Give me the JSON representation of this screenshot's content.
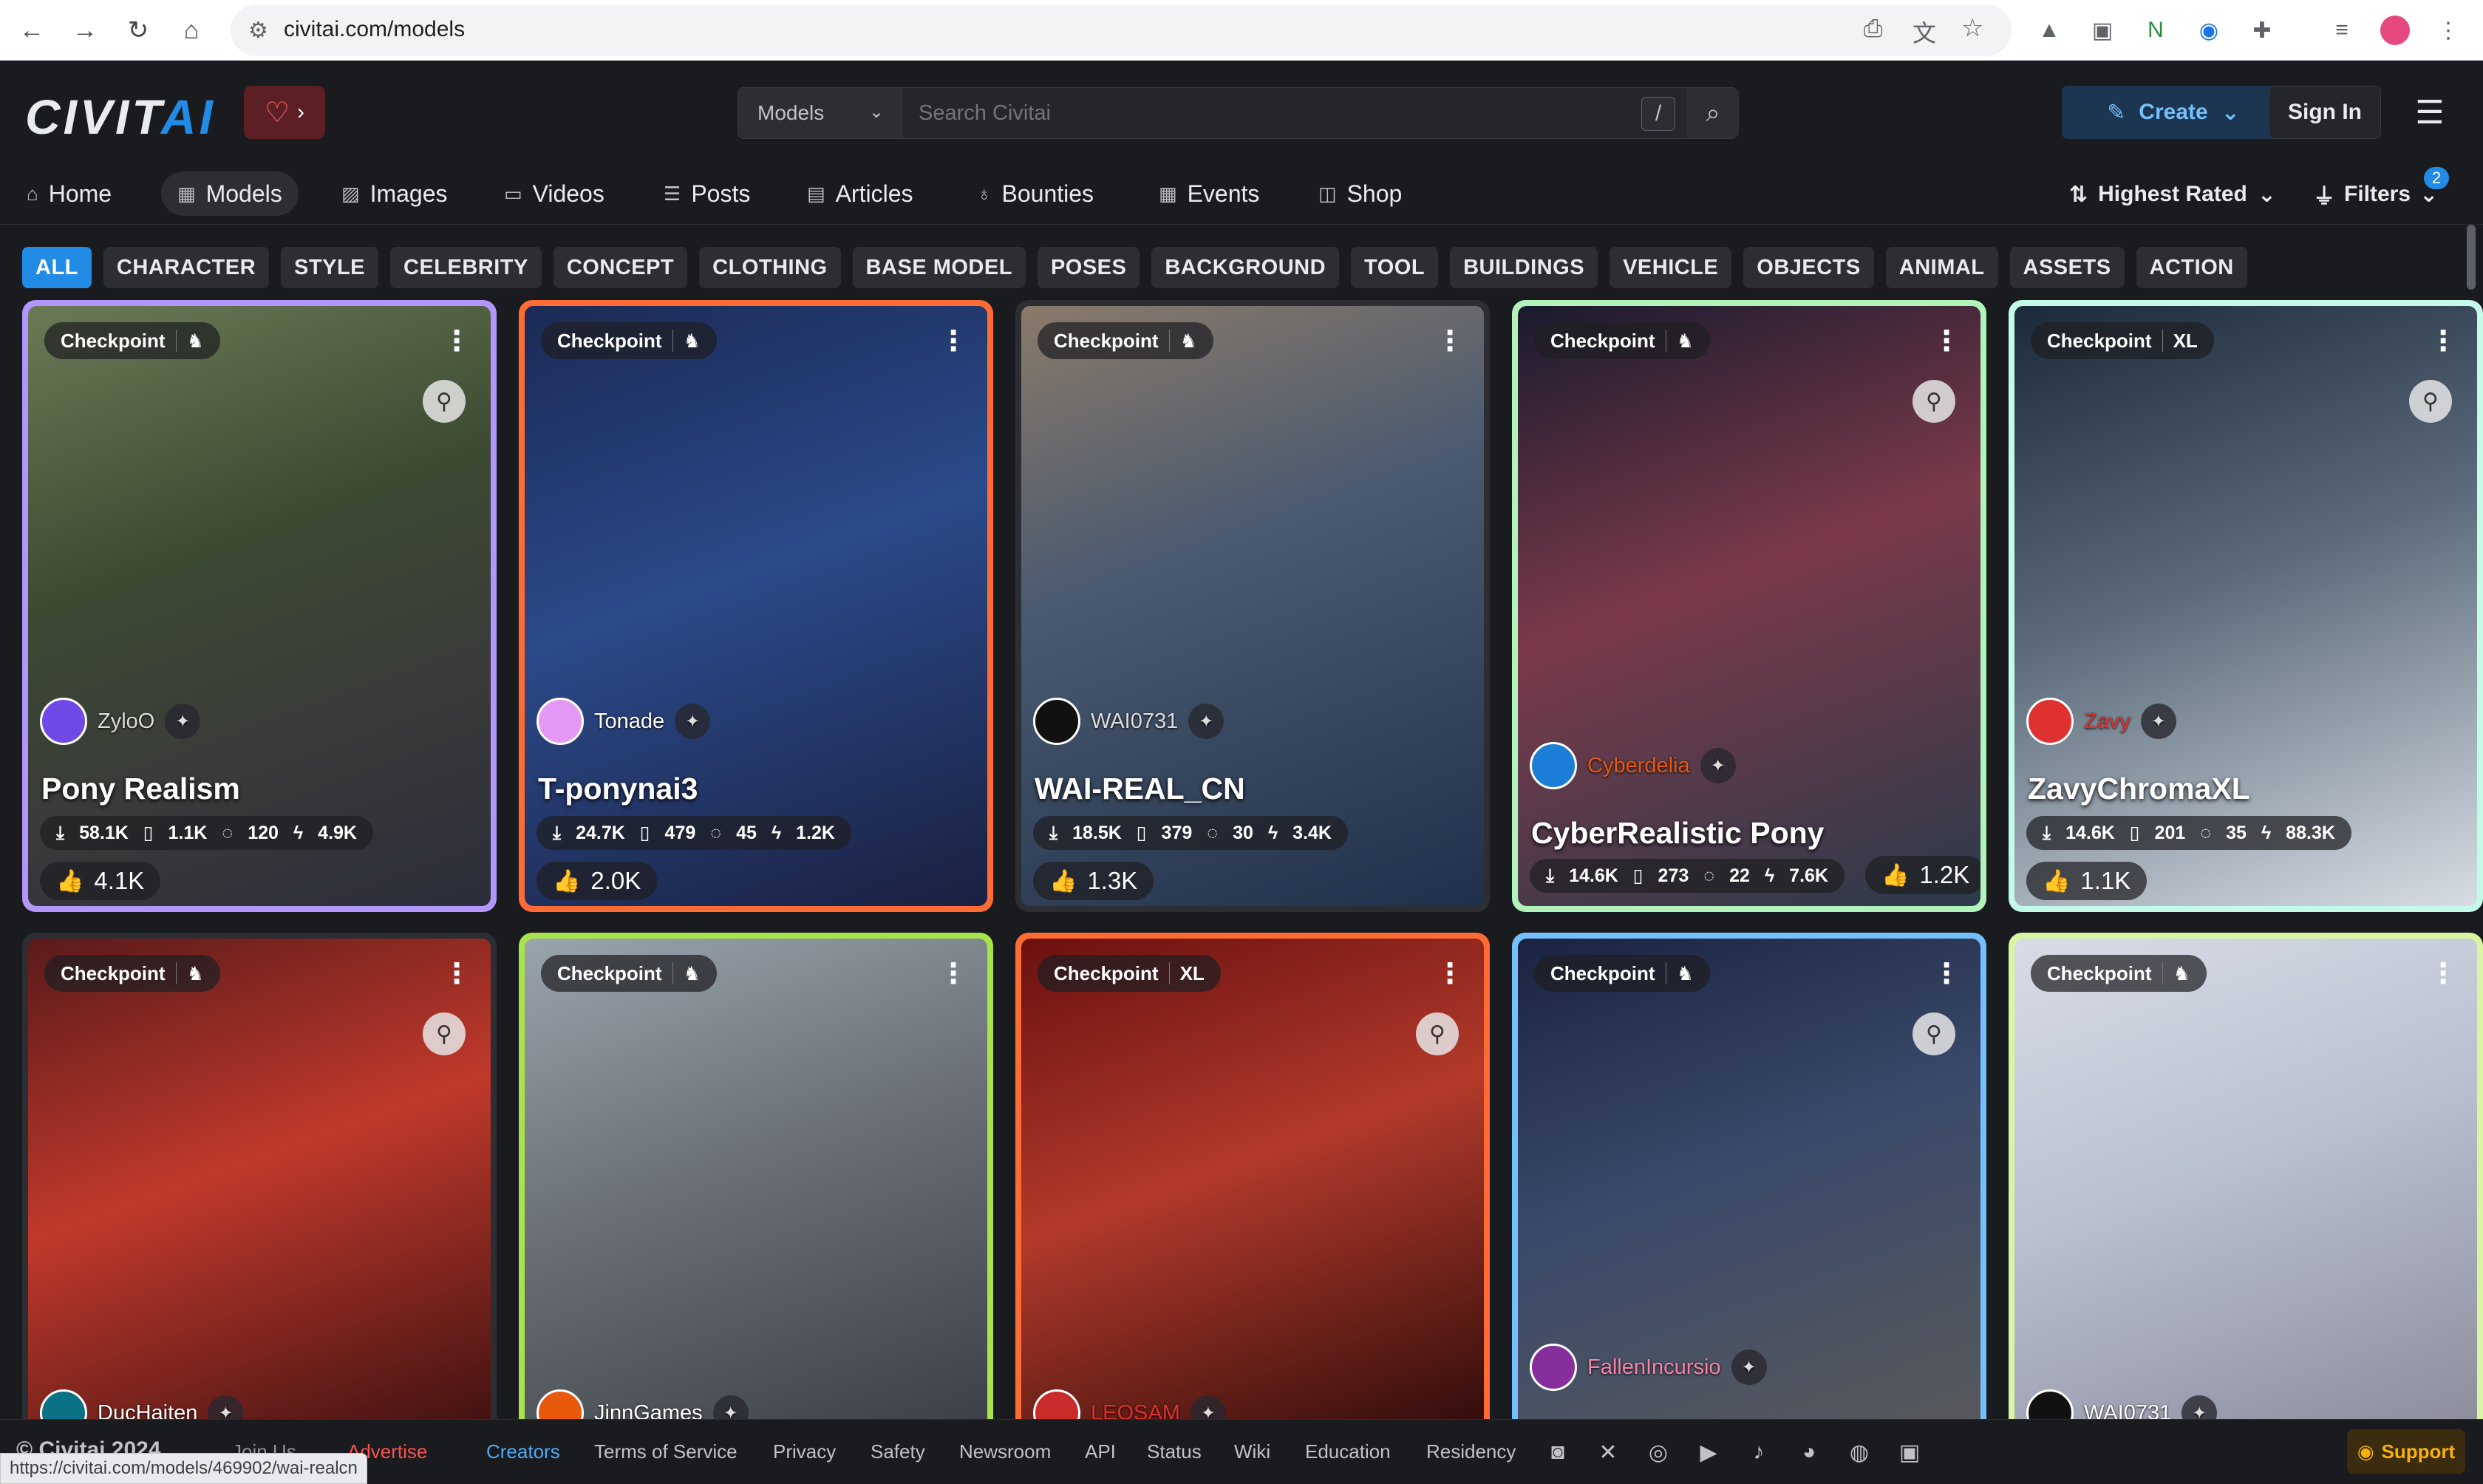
{
  "browser": {
    "url": "civitai.com/models",
    "status_url": "https://civitai.com/models/469902/wai-realcn"
  },
  "header": {
    "logo_main": "CIVIT",
    "logo_accent": "AI",
    "search_scope": "Models",
    "search_placeholder": "Search Civitai",
    "search_shortcut": "/",
    "create_label": "Create",
    "signin_label": "Sign In"
  },
  "nav": {
    "items": [
      "Home",
      "Models",
      "Images",
      "Videos",
      "Posts",
      "Articles",
      "Bounties",
      "Events",
      "Shop"
    ],
    "active": "Models",
    "sort_label": "Highest Rated",
    "filters_label": "Filters",
    "filters_count": "2"
  },
  "tags": [
    "ALL",
    "CHARACTER",
    "STYLE",
    "CELEBRITY",
    "CONCEPT",
    "CLOTHING",
    "BASE MODEL",
    "POSES",
    "BACKGROUND",
    "TOOL",
    "BUILDINGS",
    "VEHICLE",
    "OBJECTS",
    "ANIMAL",
    "ASSETS",
    "ACTION"
  ],
  "cards": [
    {
      "type": "Checkpoint",
      "base": "",
      "creator": "ZyloO",
      "title": "Pony Realism",
      "downloads": "58.1K",
      "collected": "1.1K",
      "comments": "120",
      "buzz": "4.9K",
      "likes": "4.1K",
      "border": "#b197fc"
    },
    {
      "type": "Checkpoint",
      "base": "",
      "creator": "Tonade",
      "title": "T-ponynai3",
      "downloads": "24.7K",
      "collected": "479",
      "comments": "45",
      "buzz": "1.2K",
      "likes": "2.0K",
      "border": "#ff6b35"
    },
    {
      "type": "Checkpoint",
      "base": "",
      "creator": "WAI0731",
      "title": "WAI-REAL_CN",
      "downloads": "18.5K",
      "collected": "379",
      "comments": "30",
      "buzz": "3.4K",
      "likes": "1.3K",
      "border": "#2c2e33"
    },
    {
      "type": "Checkpoint",
      "base": "",
      "creator": "Cyberdelia",
      "title": "CyberRealistic Pony",
      "downloads": "14.6K",
      "collected": "273",
      "comments": "22",
      "buzz": "7.6K",
      "likes": "1.2K",
      "border": "#b2f2bb"
    },
    {
      "type": "Checkpoint",
      "base": "XL",
      "creator": "Zavy",
      "title": "ZavyChromaXL",
      "downloads": "14.6K",
      "collected": "201",
      "comments": "35",
      "buzz": "88.3K",
      "likes": "1.1K",
      "border": "#c3fae8"
    },
    {
      "type": "Checkpoint",
      "base": "",
      "creator": "DucHaiten",
      "title": "",
      "border": "#2c2e33"
    },
    {
      "type": "Checkpoint",
      "base": "",
      "creator": "JinnGames",
      "title": "",
      "border": "#a9e34b"
    },
    {
      "type": "Checkpoint",
      "base": "XL",
      "creator": "LEOSAM",
      "title": "",
      "border": "#ff6b35"
    },
    {
      "type": "Checkpoint",
      "base": "",
      "creator": "FallenIncursio",
      "title": "",
      "border": "#74c0fc"
    },
    {
      "type": "Checkpoint",
      "base": "",
      "creator": "WAI0731",
      "title": "",
      "border": "#d8f5a2"
    }
  ],
  "footer": {
    "copyright": "© Civitai 2024",
    "links": [
      "Join Us",
      "Advertise",
      "Creators",
      "Terms of Service",
      "Privacy",
      "Safety",
      "Newsroom",
      "API",
      "Status",
      "Wiki",
      "Education",
      "Residency"
    ],
    "support_label": "Support"
  }
}
